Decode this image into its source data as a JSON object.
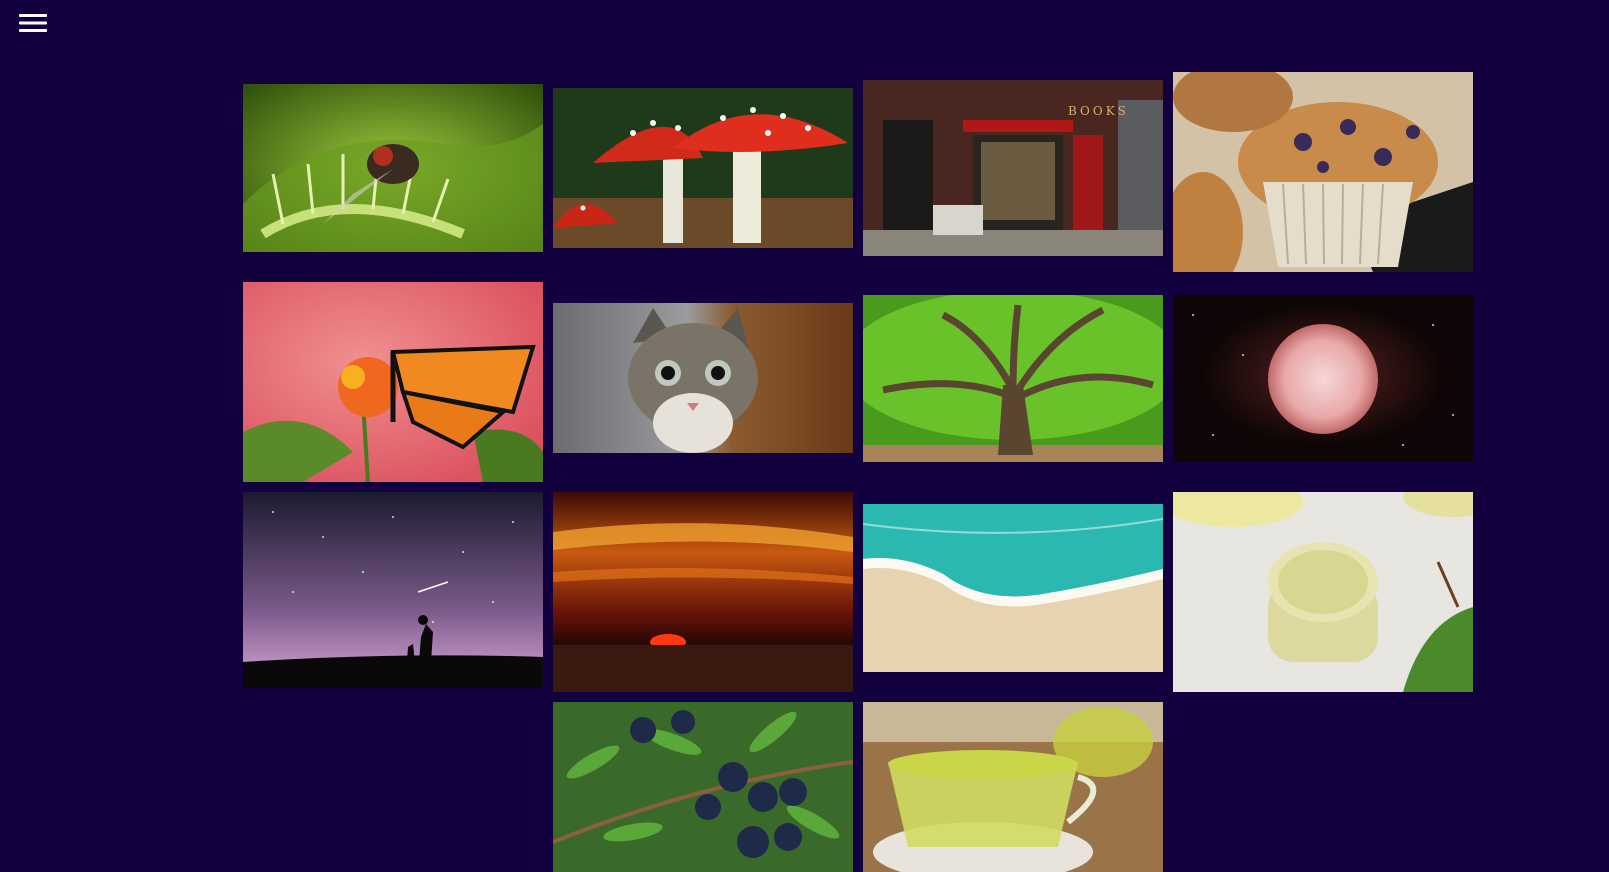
{
  "theme": {
    "background": "#12003f",
    "menu_icon_color": "#ffffff"
  },
  "toolbar": {
    "menu_icon": "hamburger-menu-icon"
  },
  "gallery": {
    "photos": [
      {
        "name": "venus-flytrap-fly-photo",
        "subject": "fly-on-venus-flytrap"
      },
      {
        "name": "red-mushrooms-photo",
        "subject": "fly-agaric-mushrooms"
      },
      {
        "name": "bookstore-photo",
        "subject": "bookstore-front"
      },
      {
        "name": "blueberry-muffins-photo",
        "subject": "blueberry-muffins"
      },
      {
        "name": "monarch-butterfly-photo",
        "subject": "monarch-on-lantana"
      },
      {
        "name": "kitten-photo",
        "subject": "tabby-kitten"
      },
      {
        "name": "oak-tree-photo",
        "subject": "angel-oak-tree"
      },
      {
        "name": "red-planet-photo",
        "subject": "pink-star-in-space"
      },
      {
        "name": "night-sky-photo",
        "subject": "starry-sky-silhouettes"
      },
      {
        "name": "sunset-photo",
        "subject": "sunset-over-sea"
      },
      {
        "name": "beach-wave-photo",
        "subject": "turquoise-wave-on-sand"
      },
      {
        "name": "balm-jar-photo",
        "subject": "jar-of-balm"
      },
      {
        "name": "blueberry-branch-photo",
        "subject": "berries-on-branch"
      },
      {
        "name": "green-tea-photo",
        "subject": "cup-of-green-tea"
      }
    ]
  },
  "shop_sign_text": "BOOKS"
}
